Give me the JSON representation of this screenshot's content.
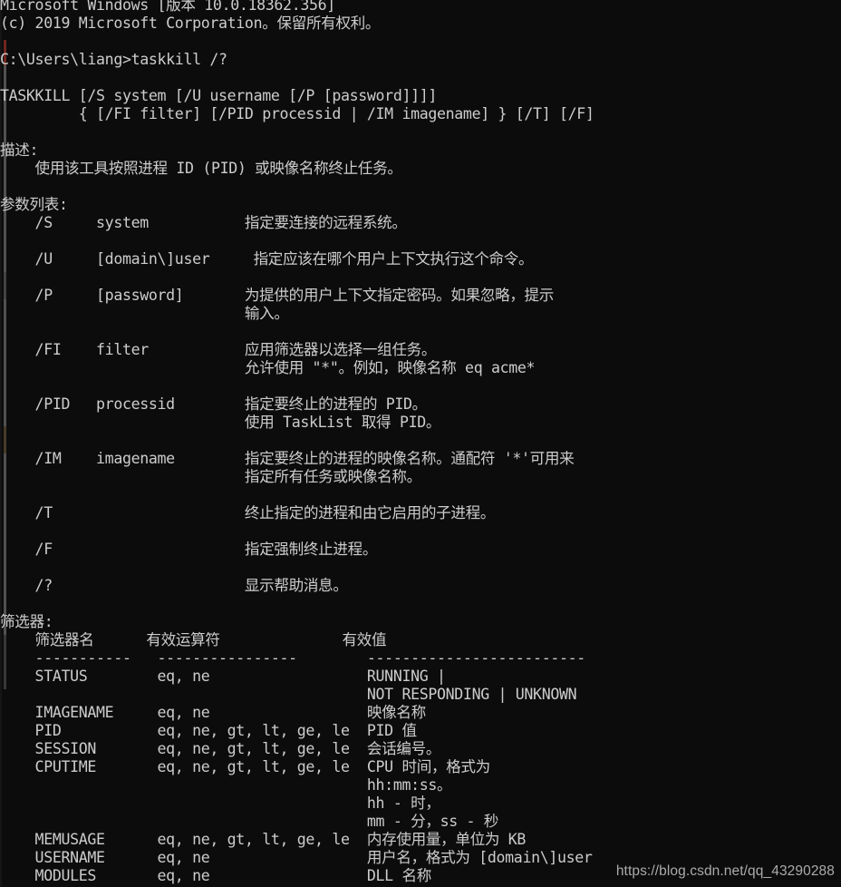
{
  "window": {
    "title": "C:\\WINDOWS\\system32\\cmd.exe",
    "background_color": "#0c0c0c",
    "foreground_color": "#cccccc"
  },
  "console": {
    "lines": [
      "Microsoft Windows [版本 10.0.18362.356]",
      "(c) 2019 Microsoft Corporation。保留所有权利。",
      "",
      "C:\\Users\\liang>taskkill /?",
      "",
      "TASKKILL [/S system [/U username [/P [password]]]]",
      "         { [/FI filter] [/PID processid | /IM imagename] } [/T] [/F]",
      "",
      "描述:",
      "    使用该工具按照进程 ID (PID) 或映像名称终止任务。",
      "",
      "参数列表:",
      "    /S     system           指定要连接的远程系统。",
      "",
      "    /U     [domain\\]user     指定应该在哪个用户上下文执行这个命令。",
      "",
      "    /P     [password]       为提供的用户上下文指定密码。如果忽略，提示",
      "                            输入。",
      "",
      "    /FI    filter           应用筛选器以选择一组任务。",
      "                            允许使用 \"*\"。例如，映像名称 eq acme*",
      "",
      "    /PID   processid        指定要终止的进程的 PID。",
      "                            使用 TaskList 取得 PID。",
      "",
      "    /IM    imagename        指定要终止的进程的映像名称。通配符 '*'可用来",
      "                            指定所有任务或映像名称。",
      "",
      "    /T                      终止指定的进程和由它启用的子进程。",
      "",
      "    /F                      指定强制终止进程。",
      "",
      "    /?                      显示帮助消息。",
      "",
      "筛选器:",
      "    筛选器名      有效运算符              有效值",
      "    -----------   ----------------        -------------------------",
      "    STATUS        eq, ne                  RUNNING |",
      "                                          NOT RESPONDING | UNKNOWN",
      "    IMAGENAME     eq, ne                  映像名称",
      "    PID           eq, ne, gt, lt, ge, le  PID 值",
      "    SESSION       eq, ne, gt, lt, ge, le  会话编号。",
      "    CPUTIME       eq, ne, gt, lt, ge, le  CPU 时间，格式为",
      "                                          hh:mm:ss。",
      "                                          hh - 时，",
      "                                          mm - 分，ss - 秒",
      "    MEMUSAGE      eq, ne, gt, lt, ge, le  内存使用量，单位为 KB",
      "    USERNAME      eq, ne                  用户名，格式为 [domain\\]user",
      "    MODULES       eq, ne                  DLL 名称"
    ],
    "command_prompt": "C:\\Users\\liang>",
    "command_entered": "taskkill /?",
    "usage_syntax_line_1": "TASKKILL [/S system [/U username [/P [password]]]]",
    "usage_syntax_line_2": "{ [/FI filter] [/PID processid | /IM imagename] } [/T] [/F]",
    "section_description_heading": "描述:",
    "section_parameters_heading": "参数列表:",
    "section_filters_heading": "筛选器:",
    "parameters": [
      {
        "switch": "/S",
        "argument": "system",
        "description": "指定要连接的远程系统。"
      },
      {
        "switch": "/U",
        "argument": "[domain\\]user",
        "description": "指定应该在哪个用户上下文执行这个命令。"
      },
      {
        "switch": "/P",
        "argument": "[password]",
        "description": "为提供的用户上下文指定密码。如果忽略，提示输入。"
      },
      {
        "switch": "/FI",
        "argument": "filter",
        "description": "应用筛选器以选择一组任务。允许使用 \"*\"。例如，映像名称 eq acme*"
      },
      {
        "switch": "/PID",
        "argument": "processid",
        "description": "指定要终止的进程的 PID。使用 TaskList 取得 PID。"
      },
      {
        "switch": "/IM",
        "argument": "imagename",
        "description": "指定要终止的进程的映像名称。通配符 '*'可用来指定所有任务或映像名称。"
      },
      {
        "switch": "/T",
        "argument": "",
        "description": "终止指定的进程和由它启用的子进程。"
      },
      {
        "switch": "/F",
        "argument": "",
        "description": "指定强制终止进程。"
      },
      {
        "switch": "/?",
        "argument": "",
        "description": "显示帮助消息。"
      }
    ],
    "filter_table": {
      "headers": [
        "筛选器名",
        "有效运算符",
        "有效值"
      ],
      "separators": [
        "-----------",
        "----------------",
        "-------------------------"
      ],
      "rows": [
        {
          "name": "STATUS",
          "operators": "eq, ne",
          "values": "RUNNING | NOT RESPONDING | UNKNOWN"
        },
        {
          "name": "IMAGENAME",
          "operators": "eq, ne",
          "values": "映像名称"
        },
        {
          "name": "PID",
          "operators": "eq, ne, gt, lt, ge, le",
          "values": "PID 值"
        },
        {
          "name": "SESSION",
          "operators": "eq, ne, gt, lt, ge, le",
          "values": "会话编号。"
        },
        {
          "name": "CPUTIME",
          "operators": "eq, ne, gt, lt, ge, le",
          "values": "CPU 时间，格式为 hh:mm:ss。hh - 时，mm - 分，ss - 秒"
        },
        {
          "name": "MEMUSAGE",
          "operators": "eq, ne, gt, lt, ge, le",
          "values": "内存使用量，单位为 KB"
        },
        {
          "name": "USERNAME",
          "operators": "eq, ne",
          "values": "用户名，格式为 [domain\\]user"
        },
        {
          "name": "MODULES",
          "operators": "eq, ne",
          "values": "DLL 名称"
        }
      ]
    }
  },
  "watermark": {
    "text": "https://blog.csdn.net/qq_43290288"
  }
}
